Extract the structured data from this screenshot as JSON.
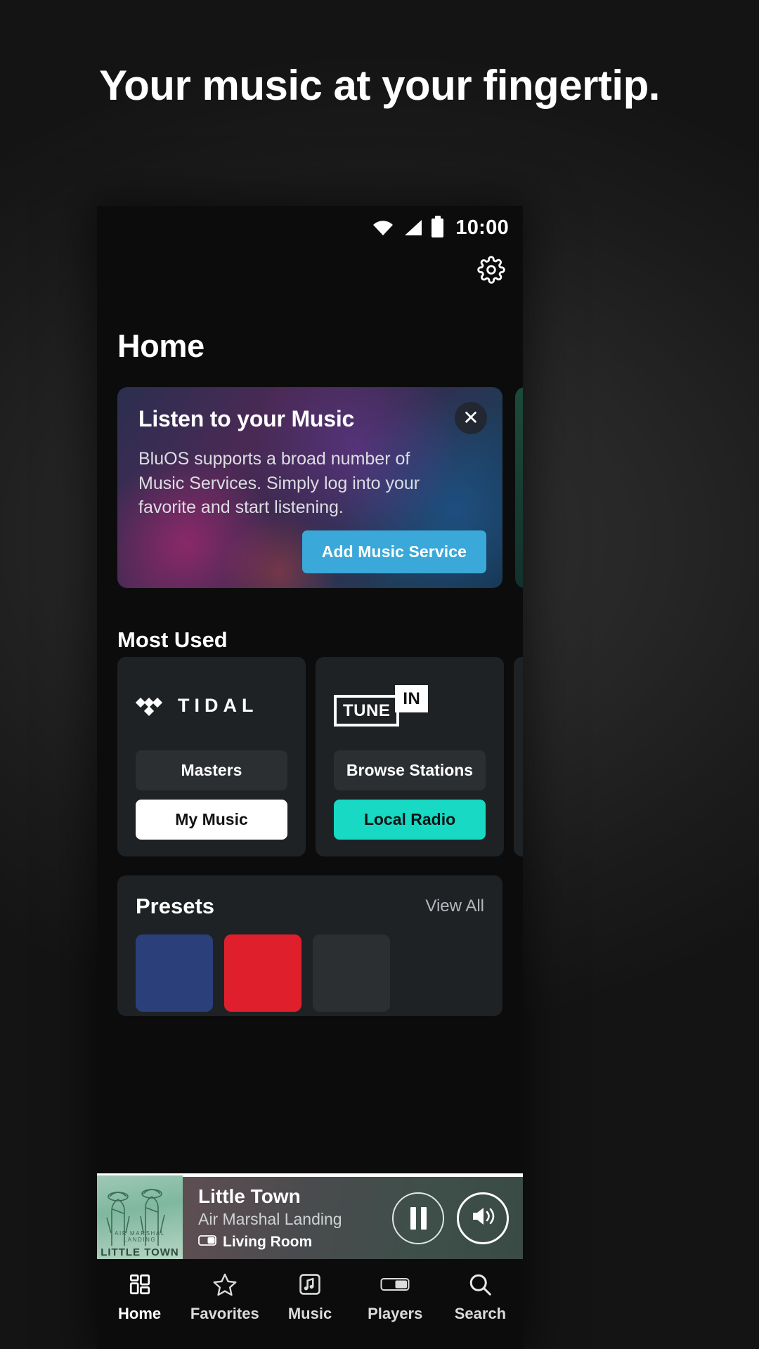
{
  "headline": "Your music at your fingertip.",
  "statusbar": {
    "time": "10:00",
    "icons": [
      "wifi-icon",
      "cellular-signal-icon",
      "battery-icon"
    ]
  },
  "header": {
    "settings_icon": "gear-icon",
    "title": "Home"
  },
  "promo": {
    "title": "Listen to your Music",
    "body": "BluOS supports a broad number of Music Services. Simply log into your favorite and start listening.",
    "button": "Add Music Service",
    "close_icon": "close-icon",
    "accent_color": "#3aa8d8"
  },
  "most_used": {
    "heading": "Most Used",
    "cards": [
      {
        "service": "TIDAL",
        "logo_icon": "tidal-logo-icon",
        "buttons": [
          {
            "label": "Masters",
            "style": "dark"
          },
          {
            "label": "My Music",
            "style": "white"
          }
        ]
      },
      {
        "service": "TuneIn",
        "logo_icon": "tunein-logo-icon",
        "logo_part1": "TUNE",
        "logo_part2": "IN",
        "buttons": [
          {
            "label": "Browse Stations",
            "style": "dark"
          },
          {
            "label": "Local Radio",
            "style": "teal"
          }
        ]
      }
    ]
  },
  "presets": {
    "title": "Presets",
    "view_all": "View All",
    "tiles": [
      "#2b3f7a",
      "#e01f2d",
      "#2b2f31"
    ]
  },
  "now_playing": {
    "track_title": "Little Town",
    "artist": "Air Marshal Landing",
    "room": "Living Room",
    "room_icon": "player-icon",
    "artwork_caption": "LITTLE TOWN",
    "artwork_subcaption": "AIR MARSHAL LANDING",
    "pause_icon": "pause-icon",
    "volume_icon": "volume-icon",
    "progress_percent": 79
  },
  "bottom_nav": {
    "active": "Home",
    "items": [
      {
        "label": "Home",
        "icon": "home-grid-icon"
      },
      {
        "label": "Favorites",
        "icon": "star-icon"
      },
      {
        "label": "Music",
        "icon": "music-note-icon"
      },
      {
        "label": "Players",
        "icon": "players-icon"
      },
      {
        "label": "Search",
        "icon": "search-icon"
      }
    ]
  },
  "colors": {
    "accent_blue": "#3aa8d8",
    "accent_teal": "#17d9c4",
    "card_bg": "#1f2224",
    "screen_bg": "#0c0c0c"
  }
}
